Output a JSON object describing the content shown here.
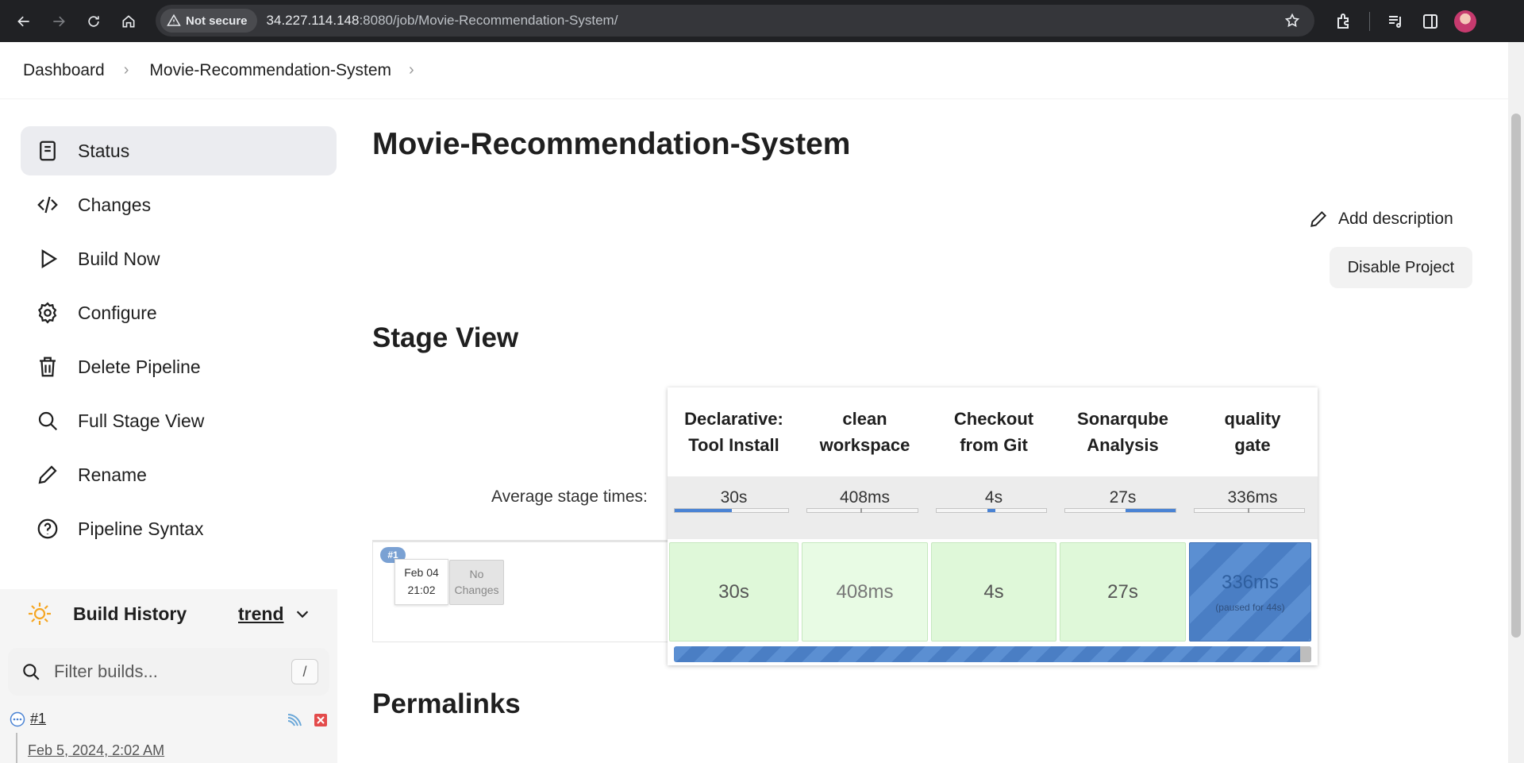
{
  "browser": {
    "security_label": "Not secure",
    "url_host": "34.227.114.148",
    "url_rest": ":8080/job/Movie-Recommendation-System/"
  },
  "breadcrumb": {
    "items": [
      "Dashboard",
      "Movie-Recommendation-System"
    ]
  },
  "sidebar": {
    "items": [
      {
        "label": "Status",
        "icon": "document-icon",
        "active": true
      },
      {
        "label": "Changes",
        "icon": "code-icon"
      },
      {
        "label": "Build Now",
        "icon": "play-icon"
      },
      {
        "label": "Configure",
        "icon": "gear-icon"
      },
      {
        "label": "Delete Pipeline",
        "icon": "trash-icon"
      },
      {
        "label": "Full Stage View",
        "icon": "search-icon"
      },
      {
        "label": "Rename",
        "icon": "pencil-icon"
      },
      {
        "label": "Pipeline Syntax",
        "icon": "help-icon"
      }
    ]
  },
  "build_history": {
    "title": "Build History",
    "trend_label": "trend",
    "filter_placeholder": "Filter builds...",
    "filter_shortcut": "/",
    "builds": [
      {
        "number": "#1",
        "date": "Feb 5, 2024, 2:02 AM"
      }
    ]
  },
  "main": {
    "title": "Movie-Recommendation-System",
    "add_description": "Add description",
    "disable_project": "Disable Project",
    "stage_view_title": "Stage View",
    "permalinks_title": "Permalinks"
  },
  "stage_view": {
    "average_label": "Average stage times:",
    "stages": [
      {
        "name_line1": "Declarative:",
        "name_line2": "Tool Install",
        "avg": "30s",
        "run": "30s",
        "avg_fill": 0.5
      },
      {
        "name_line1": "clean",
        "name_line2": "workspace",
        "avg": "408ms",
        "run": "408ms",
        "avg_fill": 0.01
      },
      {
        "name_line1": "Checkout",
        "name_line2": "from Git",
        "avg": "4s",
        "run": "4s",
        "avg_fill": 0.06
      },
      {
        "name_line1": "Sonarqube",
        "name_line2": "Analysis",
        "avg": "27s",
        "run": "27s",
        "avg_fill": 0.45
      },
      {
        "name_line1": "quality",
        "name_line2": "gate",
        "avg": "336ms",
        "run": "336ms",
        "avg_fill": 0.01,
        "note": "(paused for 44s)"
      }
    ],
    "run": {
      "badge": "#1",
      "date": "Feb 04",
      "time": "21:02",
      "changes_line1": "No",
      "changes_line2": "Changes"
    }
  },
  "colors": {
    "success_cell": "#dff8d9",
    "running_blue": "#4a7ec4",
    "accent": "#4a83d4"
  }
}
